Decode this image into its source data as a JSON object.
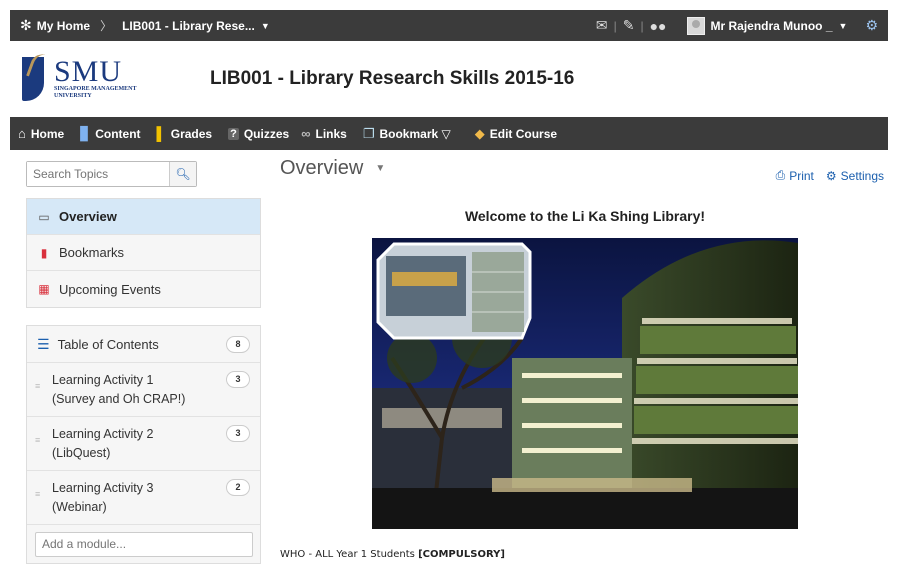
{
  "topbar": {
    "home_label": "My Home",
    "breadcrumb_course": "LIB001 - Library Rese...",
    "user_name": "Mr Rajendra Munoo _"
  },
  "header": {
    "logo_text": "SMU",
    "logo_subtext_1": "SINGAPORE MANAGEMENT",
    "logo_subtext_2": "UNIVERSITY",
    "course_title": "LIB001 - Library Research Skills 2015-16"
  },
  "nav": {
    "items": [
      {
        "label": "Home",
        "icon": "home-icon"
      },
      {
        "label": "Content",
        "icon": "book-icon"
      },
      {
        "label": "Grades",
        "icon": "grades-icon"
      },
      {
        "label": "Quizzes",
        "icon": "quiz-icon"
      },
      {
        "label": "Links",
        "icon": "link-icon"
      },
      {
        "label": "Bookmark ▽",
        "icon": "bookmark-icon"
      },
      {
        "label": "Edit Course",
        "icon": "edit-course-icon"
      }
    ]
  },
  "sidebar": {
    "search_placeholder": "Search Topics",
    "nav_items": [
      {
        "label": "Overview",
        "icon": "overview-icon"
      },
      {
        "label": "Bookmarks",
        "icon": "bookmark-icon"
      },
      {
        "label": "Upcoming Events",
        "icon": "calendar-icon"
      }
    ],
    "toc": {
      "label": "Table of Contents",
      "count": "8",
      "modules": [
        {
          "line1": "Learning Activity 1",
          "line2": "(Survey and Oh CRAP!)",
          "count": "3"
        },
        {
          "line1": "Learning Activity 2",
          "line2": "(LibQuest)",
          "count": "3"
        },
        {
          "line1": "Learning Activity 3",
          "line2": "(Webinar)",
          "count": "2"
        }
      ],
      "add_placeholder": "Add a module..."
    }
  },
  "main": {
    "title": "Overview",
    "print_label": "Print",
    "settings_label": "Settings",
    "welcome": "Welcome to the Li Ka Shing Library!",
    "who_prefix": "WHO - ALL Year 1 Students ",
    "who_bold": "[COMPULSORY]"
  },
  "colors": {
    "bar_bg": "#3b3b3b",
    "accent_blue": "#1b5fae",
    "active_row": "#d6e8f7",
    "smu_blue": "#1b3a7e",
    "smu_gold": "#b9975b"
  }
}
